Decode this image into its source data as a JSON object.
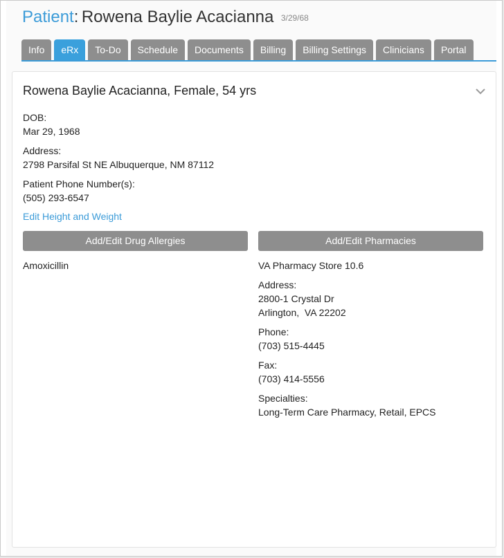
{
  "header": {
    "title_prefix": "Patient",
    "title_sep": ":",
    "patient_name": "Rowena Baylie Acacianna",
    "dob_short": "3/29/68"
  },
  "tabs": [
    {
      "label": "Info",
      "active": false
    },
    {
      "label": "eRx",
      "active": true
    },
    {
      "label": "To-Do",
      "active": false
    },
    {
      "label": "Schedule",
      "active": false
    },
    {
      "label": "Documents",
      "active": false
    },
    {
      "label": "Billing",
      "active": false
    },
    {
      "label": "Billing Settings",
      "active": false
    },
    {
      "label": "Clinicians",
      "active": false
    },
    {
      "label": "Portal",
      "active": false
    }
  ],
  "card": {
    "heading": "Rowena Baylie Acacianna, Female, 54 yrs",
    "dob_label": "DOB:",
    "dob_value": "Mar 29, 1968",
    "address_label": "Address:",
    "address_value": "2798 Parsifal St NE Albuquerque, NM 87112",
    "phone_label": "Patient Phone Number(s):",
    "phone_value": "(505) 293-6547",
    "edit_height_weight": "Edit Height and Weight",
    "chevron_icon": "chevron-down-icon"
  },
  "allergies": {
    "button_label": "Add/Edit Drug Allergies",
    "items": [
      "Amoxicillin"
    ]
  },
  "pharmacy": {
    "button_label": "Add/Edit Pharmacies",
    "name": "VA Pharmacy Store 10.6",
    "address_label": "Address:",
    "address_line1": "2800-1 Crystal Dr",
    "address_line2": "Arlington,  VA 22202",
    "phone_label": "Phone:",
    "phone_value": "(703) 515-4445",
    "fax_label": "Fax:",
    "fax_value": "(703) 414-5556",
    "specialties_label": "Specialties:",
    "specialties_value": "Long-Term Care Pharmacy, Retail, EPCS"
  },
  "colors": {
    "accent": "#3b9bd8",
    "tab_inactive": "#8e8e8e",
    "tab_active": "#3aa0dc",
    "button": "#8e8e8e"
  }
}
